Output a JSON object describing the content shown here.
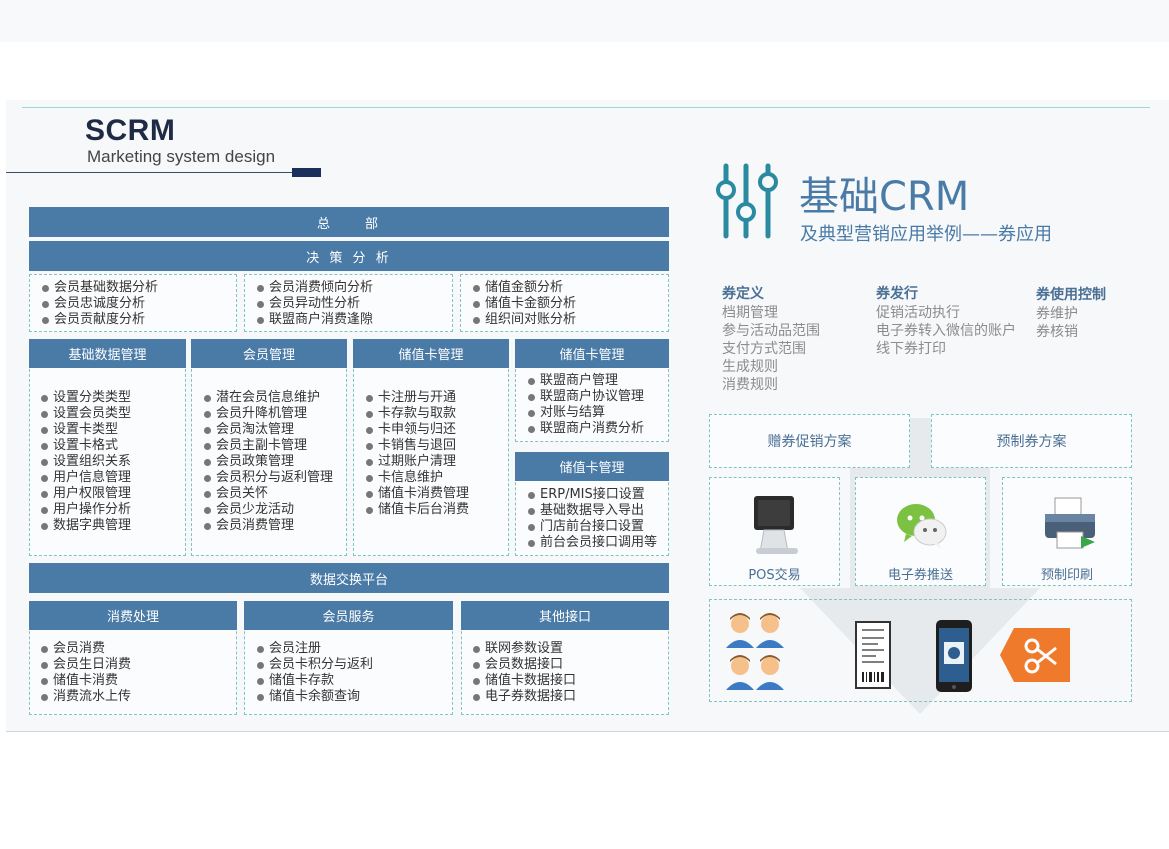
{
  "header": {
    "title": "SCRM",
    "subtitle": "Marketing system design"
  },
  "left": {
    "hq": "总　　部",
    "decision": "决 策 分 析",
    "analysis": [
      [
        "会员基础数据分析",
        "会员忠诚度分析",
        "会员贡献度分析"
      ],
      [
        "会员消费倾向分析",
        "会员异动性分析",
        "联盟商户消费逢隙"
      ],
      [
        "储值金额分析",
        "储值卡金额分析",
        "组织间对账分析"
      ]
    ],
    "modules": [
      {
        "title": "基础数据管理",
        "items": [
          "设置分类类型",
          "设置会员类型",
          "设置卡类型",
          "设置卡格式",
          "设置组织关系",
          "用户信息管理",
          "用户权限管理",
          "用户操作分析",
          "数据字典管理"
        ]
      },
      {
        "title": "会员管理",
        "items": [
          "潜在会员信息维护",
          "会员升降机管理",
          "会员淘汰管理",
          "会员主副卡管理",
          "会员政策管理",
          "会员积分与返利管理",
          "会员关怀",
          "会员少龙活动",
          "会员消费管理"
        ]
      },
      {
        "title": "储值卡管理",
        "items": [
          "卡注册与开通",
          "卡存款与取款",
          "卡申领与归还",
          "卡销售与退回",
          "过期账户清理",
          "卡信息维护",
          "储值卡消费管理",
          "储值卡后台消费"
        ]
      },
      {
        "title": "储值卡管理",
        "items": [
          "联盟商户管理",
          "联盟商户协议管理",
          "对账与结算",
          "联盟商户消费分析"
        ]
      },
      {
        "title": "储值卡管理",
        "items": [
          "ERP/MIS接口设置",
          "基础数据导入导出",
          "门店前台接口设置",
          "前台会员接口调用等"
        ]
      }
    ],
    "exchange": "数据交换平台",
    "bottom": [
      {
        "title": "消费处理",
        "items": [
          "会员消费",
          "会员生日消费",
          "储值卡消费",
          "消费流水上传"
        ]
      },
      {
        "title": "会员服务",
        "items": [
          "会员注册",
          "会员卡积分与返利",
          "储值卡存款",
          "储值卡余额查询"
        ]
      },
      {
        "title": "其他接口",
        "items": [
          "联网参数设置",
          "会员数据接口",
          "储值卡数据接口",
          "电子券数据接口"
        ]
      }
    ]
  },
  "right": {
    "title": "基础CRM",
    "subtitle": "及典型营销应用举例——券应用",
    "columns": [
      {
        "head": "券定义",
        "items": [
          "档期管理",
          "参与活动品范围",
          "支付方式范围",
          "生成规则",
          "消费规则"
        ]
      },
      {
        "head": "券发行",
        "items": [
          "促销活动执行",
          "电子券转入微信的账户",
          "线下券打印"
        ]
      },
      {
        "head": "券使用控制",
        "items": [
          "券维护",
          "券核销"
        ]
      }
    ],
    "schemes": [
      "赠券促销方案",
      "预制券方案"
    ],
    "channels": [
      "POS交易",
      "电子券推送",
      "预制印刷"
    ],
    "icons": [
      "equalizer-icon",
      "pos-terminal-icon",
      "wechat-icon",
      "printer-icon",
      "members-icon",
      "receipt-icon",
      "phone-coupon-icon",
      "scissors-coupon-icon"
    ],
    "accent": "#4a7aa6"
  }
}
